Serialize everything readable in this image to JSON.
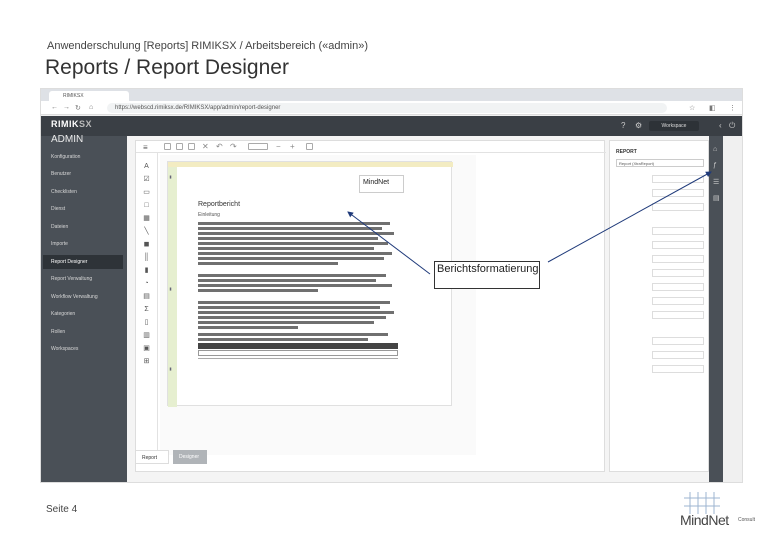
{
  "slide": {
    "header": "Anwenderschulung [Reports] RIMIKSX / Arbeitsbereich («admin»)",
    "title": "Reports / Report Designer",
    "page_label": "Seite 4"
  },
  "browser": {
    "tab_label": "RIMIKSX",
    "url": "https://webscd.rimiksx.de/RIMIKSX/app/admin/report-designer"
  },
  "app": {
    "logo": "RIMIK",
    "logo_suffix": "SX",
    "area_title": "ADMIN",
    "workspace_button": "Workspace"
  },
  "sidebar": {
    "items": [
      {
        "label": "Konfiguration"
      },
      {
        "label": "Benutzer"
      },
      {
        "label": "Checklisten"
      },
      {
        "label": "Dienst"
      },
      {
        "label": "Dateien"
      },
      {
        "label": "Importe"
      },
      {
        "label": "Report Designer"
      },
      {
        "label": "Report Verwaltung"
      },
      {
        "label": "Workflow Verwaltung"
      },
      {
        "label": "Kategorien"
      },
      {
        "label": "Rollen"
      },
      {
        "label": "Workspaces"
      }
    ],
    "active_index": 6
  },
  "report": {
    "logo_text": "MindNet",
    "title": "Reportbericht",
    "subtitle": "Einleitung"
  },
  "bottom_tabs": {
    "report": "Report",
    "designer": "Designer"
  },
  "properties": {
    "title": "REPORT",
    "selected": "Report (XtraReport)"
  },
  "callout": {
    "text": "Berichtsformatierung"
  },
  "brand": {
    "name": "MindNet",
    "tagline": "Consult"
  }
}
